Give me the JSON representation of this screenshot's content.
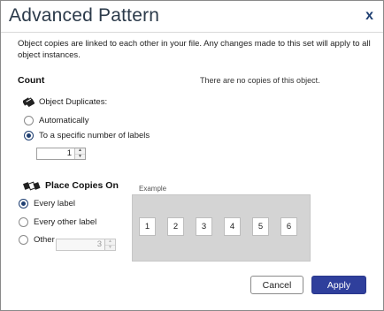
{
  "dialog": {
    "title": "Advanced Pattern",
    "close_label": "x",
    "description": "Object copies are linked to each other in your file. Any changes made to this set will apply to all object instances."
  },
  "count": {
    "heading": "Count",
    "note": "There are no copies of this object.",
    "duplicates_label": "Object Duplicates:",
    "duplicates_icon": "stack-icon",
    "options": [
      {
        "label": "Automatically",
        "selected": false
      },
      {
        "label": "To a specific number of labels",
        "selected": true
      }
    ],
    "number_value": "1"
  },
  "place": {
    "heading": "Place Copies On",
    "heading_icon": "copies-icon",
    "options": [
      {
        "label": "Every label",
        "selected": true
      },
      {
        "label": "Every other label",
        "selected": false
      },
      {
        "label": "Other",
        "selected": false
      }
    ],
    "other_value": "3"
  },
  "example": {
    "label": "Example",
    "cells": [
      "1",
      "2",
      "3",
      "4",
      "5",
      "6"
    ]
  },
  "buttons": {
    "cancel": "Cancel",
    "apply": "Apply"
  },
  "colors": {
    "accent": "#2f3f9c",
    "title": "#2b3a4a",
    "close": "#1f3f72"
  }
}
